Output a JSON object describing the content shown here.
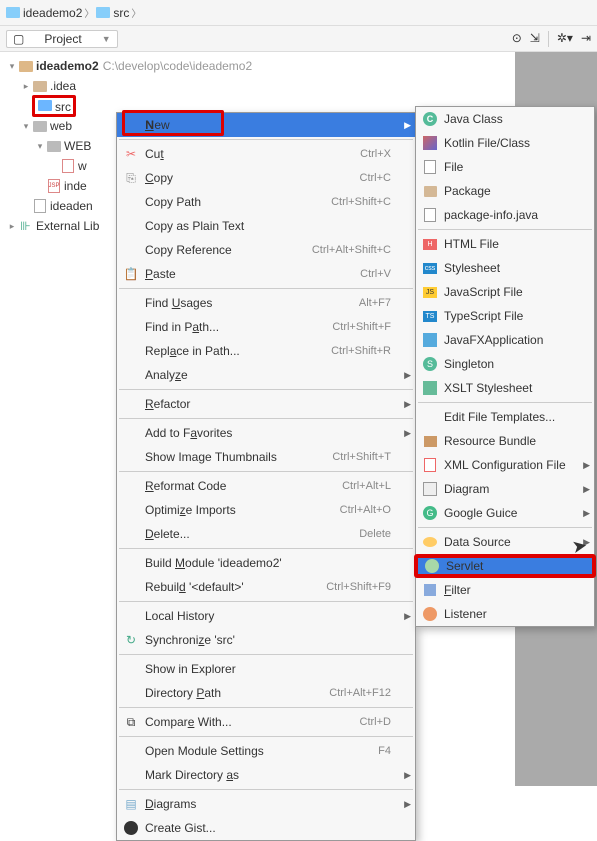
{
  "breadcrumb": {
    "items": [
      "ideademo2",
      "src"
    ]
  },
  "toolbar": {
    "project_label": "Project"
  },
  "tree": {
    "root": {
      "name": "ideademo2",
      "path": "C:\\develop\\code\\ideademo2"
    },
    "idea": ".idea",
    "src": "src",
    "web": "web",
    "webinf": "WEB",
    "webxml": "w",
    "index": "inde",
    "iml": "ideaden",
    "extlib": "External Lib"
  },
  "menu1": {
    "new": "New",
    "cut": {
      "label": "Cut",
      "sc": "Ctrl+X"
    },
    "copy": {
      "label": "Copy",
      "sc": "Ctrl+C"
    },
    "copypath": {
      "label": "Copy Path",
      "sc": "Ctrl+Shift+C"
    },
    "copyplain": {
      "label": "Copy as Plain Text"
    },
    "copyref": {
      "label": "Copy Reference",
      "sc": "Ctrl+Alt+Shift+C"
    },
    "paste": {
      "label": "Paste",
      "sc": "Ctrl+V"
    },
    "findusages": {
      "label": "Find Usages",
      "sc": "Alt+F7"
    },
    "findinpath": {
      "label": "Find in Path...",
      "sc": "Ctrl+Shift+F"
    },
    "replaceinpath": {
      "label": "Replace in Path...",
      "sc": "Ctrl+Shift+R"
    },
    "analyze": {
      "label": "Analyze"
    },
    "refactor": {
      "label": "Refactor"
    },
    "addfav": {
      "label": "Add to Favorites"
    },
    "thumbs": {
      "label": "Show Image Thumbnails",
      "sc": "Ctrl+Shift+T"
    },
    "reformat": {
      "label": "Reformat Code",
      "sc": "Ctrl+Alt+L"
    },
    "optimize": {
      "label": "Optimize Imports",
      "sc": "Ctrl+Alt+O"
    },
    "delete": {
      "label": "Delete...",
      "sc": "Delete"
    },
    "build": {
      "label": "Build Module 'ideademo2'"
    },
    "rebuild": {
      "label": "Rebuild '<default>'",
      "sc": "Ctrl+Shift+F9"
    },
    "localhist": {
      "label": "Local History"
    },
    "sync": {
      "label": "Synchronize 'src'"
    },
    "explorer": {
      "label": "Show in Explorer"
    },
    "dirpath": {
      "label": "Directory Path",
      "sc": "Ctrl+Alt+F12"
    },
    "compare": {
      "label": "Compare With...",
      "sc": "Ctrl+D"
    },
    "openmodule": {
      "label": "Open Module Settings",
      "sc": "F4"
    },
    "markdir": {
      "label": "Mark Directory as"
    },
    "diagrams": {
      "label": "Diagrams"
    },
    "gist": {
      "label": "Create Gist..."
    }
  },
  "menu2": {
    "javaclass": "Java Class",
    "kotlin": "Kotlin File/Class",
    "file": "File",
    "package": "Package",
    "pkginfo": "package-info.java",
    "html": "HTML File",
    "stylesheet": "Stylesheet",
    "jsfile": "JavaScript File",
    "tsfile": "TypeScript File",
    "javafx": "JavaFXApplication",
    "singleton": "Singleton",
    "xslt": "XSLT Stylesheet",
    "edittpl": "Edit File Templates...",
    "bundle": "Resource Bundle",
    "xmlcfg": "XML Configuration File",
    "diagram": "Diagram",
    "guice": "Google Guice",
    "datasource": "Data Source",
    "servlet": "Servlet",
    "filter": "Filter",
    "listener": "Listener"
  }
}
